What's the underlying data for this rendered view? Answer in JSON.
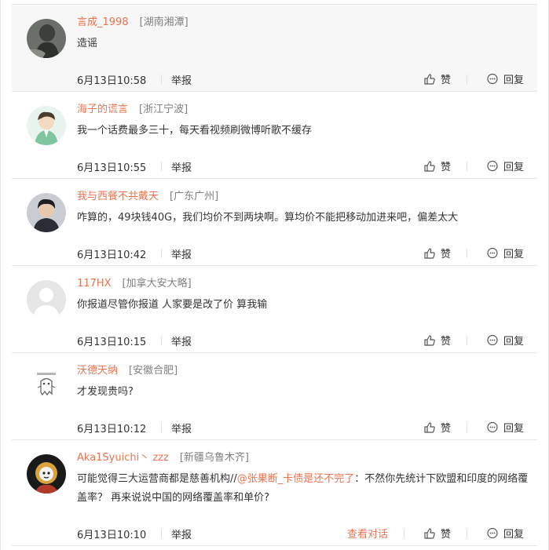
{
  "actions": {
    "like": "赞",
    "reply": "回复",
    "report": "举报"
  },
  "comments": [
    {
      "username": "言成_1998",
      "location": "[湖南湘潭]",
      "text": "造谣",
      "time": "6月13日10:58"
    },
    {
      "username": "海子的谎言",
      "location": "[浙江宁波]",
      "text": "我一个话费最多三十，每天看视频刷微博听歌不缓存",
      "time": "6月13日10:55"
    },
    {
      "username": "我与西餐不共戴天",
      "location": "[广东广州]",
      "text": "咋算的，49块钱40G，我们均价不到两块啊。算均价不能把移动加进来吧，偏差太大",
      "time": "6月13日10:42"
    },
    {
      "username": "117HX",
      "location": "[加拿大安大略]",
      "text": "你报道尽管你报道 人家要是改了价 算我输",
      "time": "6月13日10:15"
    },
    {
      "username": "沃德天纳",
      "location": "[安徽合肥]",
      "text": "才发现贵吗?",
      "time": "6月13日10:12"
    },
    {
      "username": "Aka1Syuichi丶 zzz",
      "location": "[新疆乌鲁木齐]",
      "text_before": "可能觉得三大运营商都是慈善机构//",
      "mention": "@张果断_卡债是还不完了",
      "text_after": "：不然你先统计下欧盟和印度的网络覆盖率？ 再来说说中国的网络覆盖率和单价?",
      "time": "6月13日10:10",
      "view_conversation": "查看对话"
    }
  ]
}
